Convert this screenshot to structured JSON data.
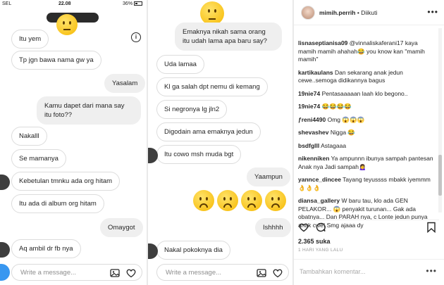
{
  "panel1": {
    "status": {
      "carrier": "SEL",
      "time": "22.08",
      "battery": "36%"
    },
    "messages": [
      {
        "side": "in",
        "text": "Itu yem"
      },
      {
        "side": "in",
        "text": "Tp jgn bawa nama gw ya"
      },
      {
        "side": "out",
        "text": "Yasalam"
      },
      {
        "side": "out",
        "text": "Kamu dapet dari mana say itu foto??"
      },
      {
        "side": "in",
        "text": "Nakalll"
      },
      {
        "side": "in",
        "text": "Se mamanya"
      },
      {
        "side": "in",
        "text": "Kebetulan tmnku ada org hitam"
      },
      {
        "side": "in",
        "text": "Itu ada di album org hitam"
      },
      {
        "side": "out",
        "text": "Omaygot"
      },
      {
        "side": "in",
        "text": "Aq ambil dr fb nya"
      }
    ],
    "composer_placeholder": "Write a message...",
    "info_glyph": "i"
  },
  "panel2": {
    "messages": [
      {
        "side": "out",
        "text": "Emaknya nikah sama orang itu udah lama apa baru say?"
      },
      {
        "side": "in",
        "text": "Uda lamaa"
      },
      {
        "side": "in",
        "text": "Kl ga salah dpt nemu di kemang"
      },
      {
        "side": "in",
        "text": "Si negronya lg jln2"
      },
      {
        "side": "in",
        "text": "Digodain ama emaknya jedun"
      },
      {
        "side": "in",
        "text": "Itu cowo msh muda bgt"
      },
      {
        "side": "out",
        "text": "Yaampun"
      },
      {
        "side": "out",
        "text": "Ishhhh"
      },
      {
        "side": "in",
        "text": "Nakal pokoknya dia"
      }
    ],
    "composer_placeholder": "Write a message..."
  },
  "panel3": {
    "username": "mimih.perrih",
    "follow_label": "• Diikuti",
    "comments": [
      {
        "user": "lisnaseptianisa09",
        "text": "@vinnaliskaferani17 kaya mamih mamih ahahah😂 you know kan \"mamih mamih\""
      },
      {
        "user": "kartikaulans",
        "text": "Dan sekarang anak jedun cewe..semoga didikannya bagus"
      },
      {
        "user": "19nie74",
        "text": "Pentasaaaaan laah klo begono.."
      },
      {
        "user": "19nie74",
        "text": "😂😂😂😂"
      },
      {
        "user": "ƒreni4490",
        "text": "Omg 😱😱😱"
      },
      {
        "user": "shevashev",
        "text": "Nigga 😂"
      },
      {
        "user": "bsdfglll",
        "text": "Astagaaa"
      },
      {
        "user": "nikenniken",
        "text": "Ya ampunnn ibunya sampah pantesan Anak nya Jadi sampah🙍‍♀️"
      },
      {
        "user": "yannce_dincee",
        "text": "Tayang teyussss mbakk iyemmm👌👌👌"
      },
      {
        "user": "diansa_gallery",
        "text": "W baru tau, klo ada GEN PELAKOR... 😱 penyakit turunan... Gak ada obatnya... Dan PARAH nya, c Lonte jedun punya anak cwe! Smg ajaaa dy"
      }
    ],
    "likes": "2.365 suka",
    "time_ago": "1 HARI YANG LALU",
    "comment_placeholder": "Tambahkan komentar...",
    "more_glyph": "•••"
  },
  "colors": {
    "accent": "#3897f0",
    "incoming_border": "#dcdcdc",
    "outgoing_fill": "#efefef"
  }
}
